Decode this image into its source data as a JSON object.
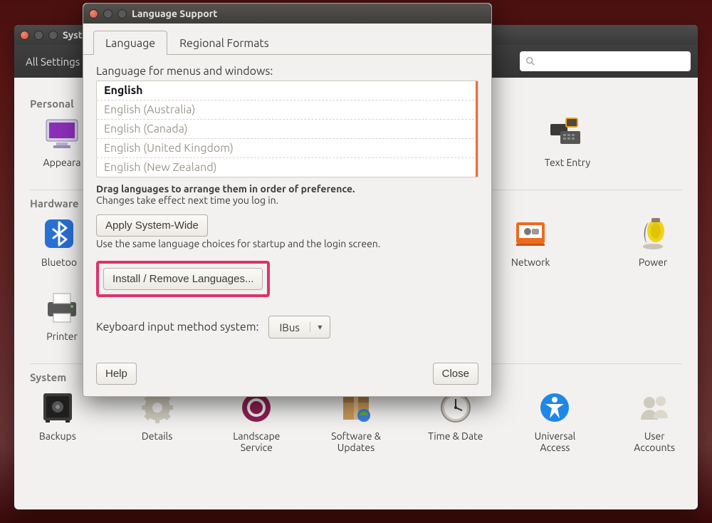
{
  "bg_window": {
    "title": "System Settings",
    "title_truncated": "Syst",
    "all_settings": "All Settings",
    "sections": {
      "personal": "Personal",
      "hardware": "Hardware",
      "system": "System"
    },
    "icons": {
      "appearance": "Appearance",
      "appearance_truncated": "Appeara",
      "text_entry": "Text Entry",
      "bluetooth": "Bluetooth",
      "bluetooth_truncated": "Bluetoo",
      "network": "Network",
      "power": "Power",
      "printers": "Printers",
      "printers_truncated": "Printer",
      "backups": "Backups",
      "details": "Details",
      "landscape": "Landscape Service",
      "software": "Software & Updates",
      "timedate": "Time & Date",
      "universal": "Universal Access",
      "users": "User Accounts"
    }
  },
  "dialog": {
    "title": "Language Support",
    "tabs": {
      "language": "Language",
      "regional": "Regional Formats"
    },
    "lang_label": "Language for menus and windows:",
    "languages": [
      "English",
      "English (Australia)",
      "English (Canada)",
      "English (United Kingdom)",
      "English (New Zealand)"
    ],
    "drag_hint_strong": "Drag languages to arrange them in order of preference.",
    "drag_hint": "Changes take effect next time you log in.",
    "apply_btn": "Apply System-Wide",
    "apply_hint": "Use the same language choices for startup and the login screen.",
    "install_btn": "Install / Remove Languages...",
    "keyboard_label": "Keyboard input method system:",
    "keyboard_value": "IBus",
    "help_btn": "Help",
    "close_btn": "Close"
  }
}
